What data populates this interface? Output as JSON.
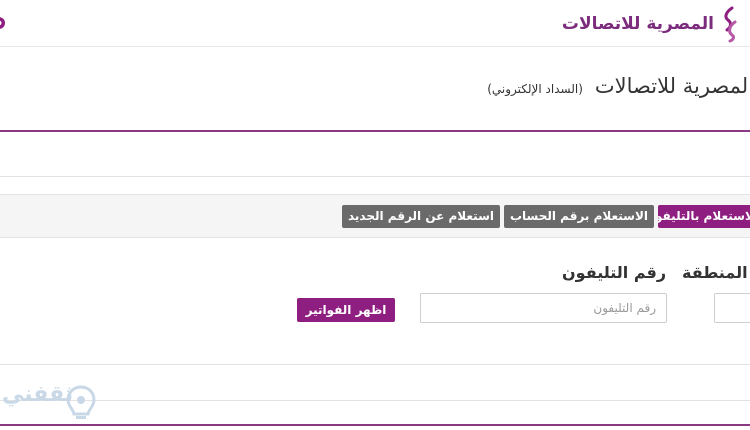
{
  "header": {
    "brand_name": "المصرية للاتصالات",
    "page_title": "المصرية للاتصالات",
    "subtitle": "(السداد الإلكتروني)"
  },
  "tabs": [
    {
      "label": "الاستعلام بالتليفون",
      "active": true
    },
    {
      "label": "الاستعلام برقم الحساب",
      "active": false
    },
    {
      "label": "استعلام عن الرقم الجديد",
      "active": false
    }
  ],
  "form": {
    "area_code_label": "كود المنطقة",
    "phone_label": "رقم التليفون",
    "phone_placeholder": "رقم التليفون",
    "show_bills_button": "اظهر الفواتير"
  },
  "watermark": {
    "text": "ثقفني"
  },
  "colors": {
    "accent": "#8e1e80",
    "idle_tab": "#6a6a6a",
    "rule": "#8a3a84"
  }
}
